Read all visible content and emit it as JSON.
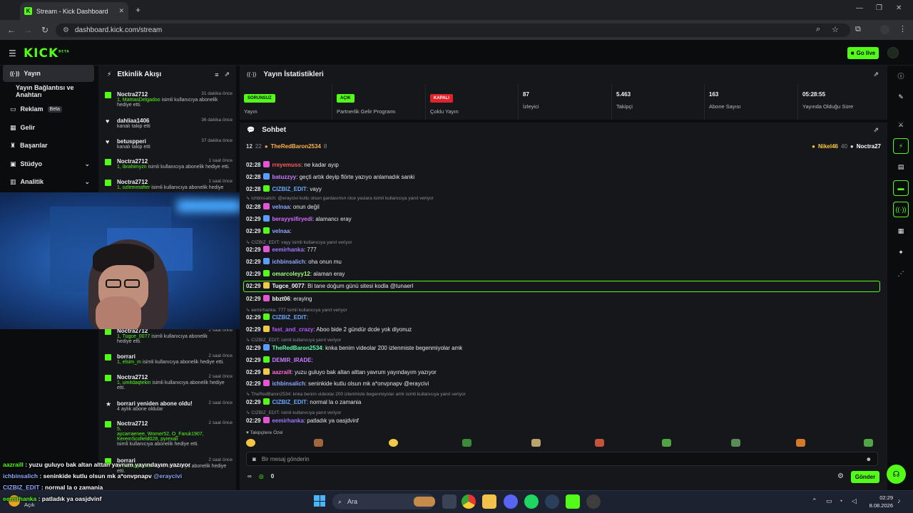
{
  "browser": {
    "tab_title": "Stream - Kick Dashboard",
    "url": "dashboard.kick.com/stream"
  },
  "header": {
    "logo": "KICK",
    "logo_sup": "BETA",
    "go_live": "Go live"
  },
  "nav": {
    "items": [
      {
        "label": "Yayın"
      },
      {
        "label": "Yayın Bağlantısı ve Anahtarı"
      },
      {
        "label": "Reklam",
        "badge": "Beta"
      },
      {
        "label": "Gelir"
      },
      {
        "label": "Başarılar"
      },
      {
        "label": "Stüdyo"
      },
      {
        "label": "Analitik"
      }
    ]
  },
  "activity": {
    "title": "Etkinlik Akışı",
    "items": [
      {
        "name": "Noctra2712",
        "time": "31 dakika önce",
        "line1": "1, MatriasDelgadoo",
        "line1b": " isimli kullanıcıya abonelik",
        "line2": "hediye etti."
      },
      {
        "name": "dahliaa1406",
        "time": "36 dakika önce",
        "line2": "kanalı takip etti"
      },
      {
        "name": "betuspperi",
        "time": "37 dakika önce",
        "line2": "kanalı takip etti"
      },
      {
        "name": "Noctra2712",
        "time": "1 saat önce",
        "line1": "1, ibrahimyzn",
        "line1b": " isimli kullanıcıya abonelik hediye etti."
      },
      {
        "name": "Noctra2712",
        "time": "1 saat önce",
        "line1": "1, ozlemmafter",
        "line1b": " isimli kullanıcıya abonelik hediye"
      },
      {
        "name": "Noctra2712",
        "time": "2 saat önce",
        "line1": "1, Tugce_0077",
        "line1b": " isimli kullanıcıya abonelik",
        "line2": "hediye etti."
      },
      {
        "name": "borrari",
        "time": "2 saat önce",
        "line1": "1, elsim_m",
        "line1b": " isimli kullanıcıya abonelik hediye etti."
      },
      {
        "name": "Noctra2712",
        "time": "2 saat önce",
        "line1": "1, umitdaqtekin",
        "line1b": " isimli kullanıcıya abonelik hediye",
        "line2": "etti."
      },
      {
        "name": "borrari yeniden abone oldu!",
        "time": "2 saat önce",
        "line2": "4 aylık abone oldular"
      },
      {
        "name": "Noctra2712",
        "time": "2 saat önce",
        "line1": "5,",
        "line1c": "aycarraenee, Womer52, O_Faruk1907,",
        "line1d": "KeremScofield028, pyrexali",
        "line2": "isimli kullanıcıya abonelik hediye etti."
      },
      {
        "name": "borrari",
        "time": "2 saat önce",
        "line1": "1, mahsnpdemir",
        "line1b": " isimli kullanıcıya abonelik hediye",
        "line2": "etti."
      }
    ]
  },
  "overlay": [
    {
      "user": "aazraill",
      "text": " : yuzu guluyo bak altan alttan yavrum yayındayım yazıyor"
    },
    {
      "user": "ichbinsalich",
      "text": " : seninkide kutlu olsun mk a*onvpnapv",
      "mention": " @eraycivi"
    },
    {
      "user": "CIZBIZ_EDIT",
      "text": " : normal la o zamania"
    },
    {
      "user": "eemirhanka",
      "text": " : patladık ya oasjdvinf"
    }
  ],
  "stats": {
    "title": "Yayın İstatistikleri",
    "cards": [
      {
        "badge": "SORUNSUZ",
        "label": "Yayın"
      },
      {
        "badge": "AÇIK",
        "label": "Partnerlik Gelir Programı"
      },
      {
        "badge": "KAPALI",
        "label": "Çoklu Yayın"
      },
      {
        "value": "87",
        "label": "İzleyici"
      },
      {
        "value": "5.463",
        "label": "Takipçi"
      },
      {
        "value": "163",
        "label": "Abone Sayısı"
      },
      {
        "value": "05:28:55",
        "label": "Yayında Olduğu Süre"
      }
    ]
  },
  "chat": {
    "title": "Sohbet",
    "top_left": "12",
    "top_left2": "22",
    "top_user": "TheRedBaron2534",
    "top_user_count": "8",
    "top_right_user": "Nikel46",
    "top_right_count": "40",
    "top_right_user2": "Noctra27",
    "messages": [
      {
        "time": "02:28",
        "user": "rreyemuss",
        "color": "#ff5a5a",
        "text": ": ne kadar ayıp"
      },
      {
        "time": "02:28",
        "user": "batuzzyy",
        "color": "#c77dff",
        "text": ": geçti artık deyip flörte yazıyo anlamadık sanki"
      },
      {
        "time": "02:28",
        "user": "CIZBIZ_EDIT",
        "color": "#6aa6ff",
        "text": ": vayy"
      },
      {
        "reply": "ichbinsalich: @eraycivi kutlu olsun gardasımın nice yaslara isimli kullanıcıya yanıt veriyor"
      },
      {
        "time": "02:28",
        "user": "velnaa",
        "color": "#8fa8ff",
        "text": ": onun değil"
      },
      {
        "time": "02:29",
        "user": "berayysifiryedi",
        "color": "#d66bff",
        "text": ": alamancı eray"
      },
      {
        "time": "02:29",
        "user": "velnaa",
        "color": "#8fa8ff",
        "text": ":"
      },
      {
        "reply": "CIZBIZ_EDIT: vayy isimli kullanıcıya yanıt veriyor"
      },
      {
        "time": "02:29",
        "user": "eemirhanka",
        "color": "#a078ff",
        "text": ": 777"
      },
      {
        "time": "02:29",
        "user": "ichbinsalich",
        "color": "#8fa8ff",
        "text": ": oha onun mu"
      },
      {
        "time": "02:29",
        "user": "omarcoleyy12",
        "color": "#9dff7a",
        "text": ": alaman eray"
      },
      {
        "time": "02:29",
        "user": "Tugce_0077",
        "color": "#ffffff",
        "text": ": Bi tane doğum günü sitesi kodla @tunaerl"
      },
      {
        "time": "02:29",
        "user": "bbzt06",
        "color": "#ffffff",
        "text": ": eraying"
      },
      {
        "reply": "eemirhanka: 777 isimli kullanıcıya yanıt veriyor"
      },
      {
        "time": "02:29",
        "user": "CIZBIZ_EDIT",
        "color": "#6aa6ff",
        "text": ":"
      },
      {
        "time": "02:29",
        "user": "fast_and_crazy",
        "color": "#b45bff",
        "text": ": Aboo bide 2 gündür dcde yok diyonuz"
      },
      {
        "reply": "CIZBIZ_EDIT: isimli kullanıcıya yanıt veriyor"
      },
      {
        "time": "02:29",
        "user": "TheRedBaron2534",
        "color": "#5bffb0",
        "text": ": knka benim videolar 200 izlenmiste begenmiyolar amk"
      },
      {
        "time": "02:29",
        "user": "DEMIR_IRADE",
        "color": "#c77dff",
        "text": ":"
      },
      {
        "time": "02:29",
        "user": "aazraill",
        "color": "#ff6ad5",
        "text": ": yuzu guluyo bak altan alttan yavrum yayındayım yazıyor"
      },
      {
        "time": "02:29",
        "user": "ichbinsalich",
        "color": "#8fa8ff",
        "text": ": seninkide kutlu olsun mk a*onvpnapv @eraycivi"
      },
      {
        "reply": "TheRedBaron2534: knka benim videolar 200 izlenmiste begenmiyolar amk isimli kullanıcıya yanıt veriyor"
      },
      {
        "time": "02:29",
        "user": "CIZBIZ_EDIT",
        "color": "#6aa6ff",
        "text": ": normal la o zamania"
      },
      {
        "reply": "CIZBIZ_EDIT: isimli kullanıcıya yanıt veriyor"
      },
      {
        "time": "02:29",
        "user": "eemirhanka",
        "color": "#a078ff",
        "text": ": patladık ya oasjdvinf"
      }
    ],
    "followers_only": "Takipçilere Özel",
    "placeholder": "Bir mesaj gönderin",
    "points": "0",
    "send": "Gönder"
  },
  "taskbar": {
    "weather": "Açık",
    "search": "Ara",
    "time": "02:29",
    "date": "8.08.2026"
  },
  "colors": {
    "accent": "#53fc18",
    "panel": "#16171a",
    "bg": "#0b0c0e"
  }
}
